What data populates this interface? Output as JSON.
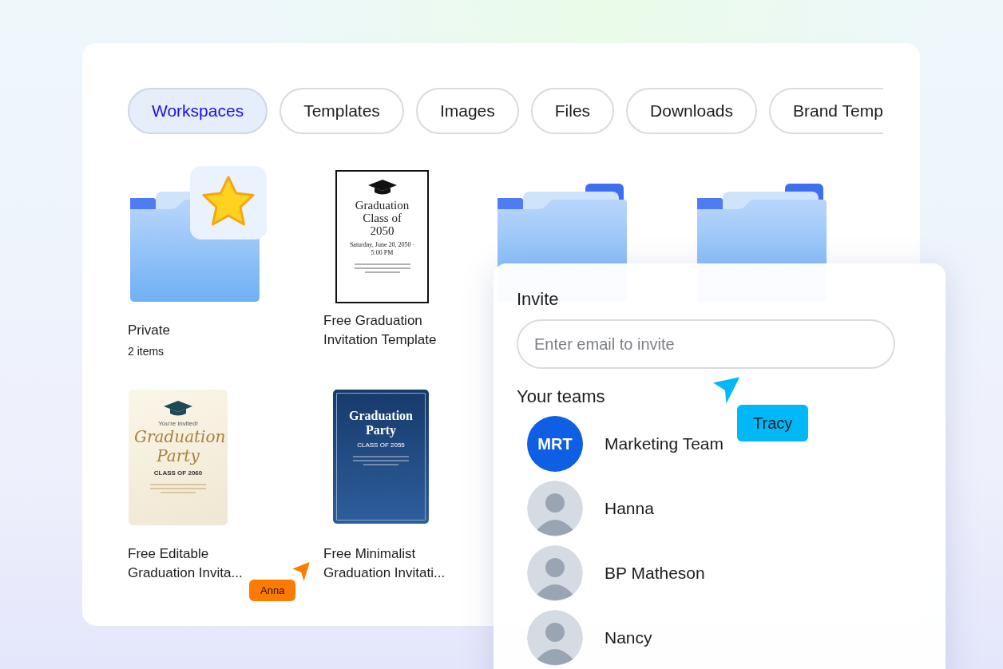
{
  "tabs": [
    {
      "label": "Workspaces",
      "selected": true
    },
    {
      "label": "Templates",
      "selected": false
    },
    {
      "label": "Images",
      "selected": false
    },
    {
      "label": "Files",
      "selected": false
    },
    {
      "label": "Downloads",
      "selected": false
    },
    {
      "label": "Brand Temp",
      "selected": false
    }
  ],
  "items": [
    {
      "kind": "folder",
      "starred": true,
      "title": "Private",
      "subtitle": "2 items"
    },
    {
      "kind": "document",
      "title": "Free Graduation Invitation Template",
      "preview": {
        "kind": "classic",
        "heading": "Graduation Class of 2050",
        "lines": [
          "Saturday, June 20, 2050 · 5:00 PM"
        ]
      }
    },
    {
      "kind": "folder",
      "starred": false
    },
    {
      "kind": "folder",
      "starred": false
    },
    {
      "kind": "document",
      "title": "Free Editable Graduation Invita...",
      "preview": {
        "kind": "cream",
        "kicker": "You're invited!",
        "heading": "Graduation Party",
        "lines": [
          "CLASS OF 2060"
        ]
      }
    },
    {
      "kind": "document",
      "title": "Free Minimalist Graduation Invitati...",
      "preview": {
        "kind": "navy",
        "heading": "Graduation Party",
        "lines": [
          "CLASS OF 2055"
        ]
      }
    }
  ],
  "invite": {
    "title": "Invite",
    "email_field": {
      "placeholder": "Enter email to invite"
    },
    "teams_heading": "Your teams",
    "members": [
      {
        "kind": "initials",
        "initials": "MRT",
        "name": "Marketing Team"
      },
      {
        "kind": "photo",
        "name": "Hanna"
      },
      {
        "kind": "photo",
        "name": "BP Matheson"
      },
      {
        "kind": "photo",
        "name": "Nancy"
      }
    ]
  },
  "cursors": [
    {
      "name": "Tracy",
      "color": "#00b8f5"
    },
    {
      "name": "Anna",
      "color": "#ff7a00"
    }
  ]
}
